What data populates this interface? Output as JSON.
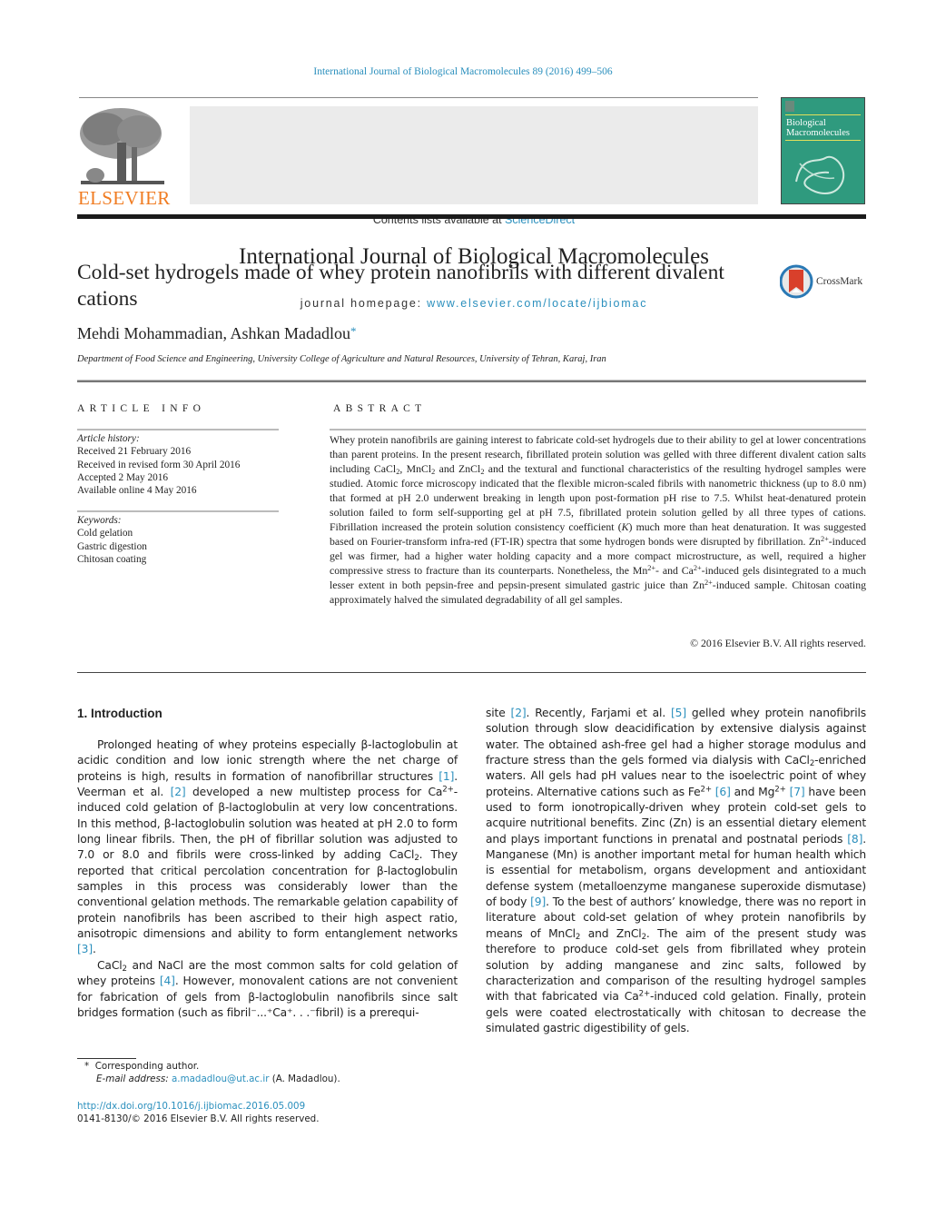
{
  "running_head": "International Journal of Biological Macromolecules 89 (2016) 499–506",
  "header": {
    "publisher": "ELSEVIER",
    "contents_prefix": "Contents lists available at ",
    "contents_link": "ScienceDirect",
    "journal_title": "International Journal of Biological Macromolecules",
    "homepage_prefix": "journal homepage: ",
    "homepage_link": "www.elsevier.com/locate/ijbiomac",
    "cover_title_line1": "Biological",
    "cover_title_line2": "Macromolecules",
    "cover_color": "#2f9a7e",
    "publisher_color": "#f07c22",
    "link_color": "#2a8fbd"
  },
  "article": {
    "title": "Cold-set hydrogels made of whey protein nanofibrils with different divalent cations",
    "crossmark_label": "CrossMark",
    "authors": "Mehdi Mohammadian, Ashkan Madadlou",
    "author_mark": "*",
    "affiliation": "Department of Food Science and Engineering, University College of Agriculture and Natural Resources, University of Tehran, Karaj, Iran"
  },
  "article_info": {
    "heading": "ARTICLE INFO",
    "history_label": "Article history:",
    "history": [
      "Received 21 February 2016",
      "Received in revised form 30 April 2016",
      "Accepted 2 May 2016",
      "Available online 4 May 2016"
    ],
    "keywords_label": "Keywords:",
    "keywords": [
      "Cold gelation",
      "Gastric digestion",
      "Chitosan coating"
    ]
  },
  "abstract": {
    "heading": "ABSTRACT",
    "s1": "Whey protein nanofibrils are gaining interest to fabricate cold-set hydrogels due to their ability to gel at lower concentrations than parent proteins. In the present research, fibrillated protein solution was gelled with three different divalent cation salts including CaCl",
    "s2": ", MnCl",
    "s3": " and ZnCl",
    "s4": " and the textural and functional characteristics of the resulting hydrogel samples were studied. Atomic force microscopy indicated that the flexible micron-scaled fibrils with nanometric thickness (up to 8.0 nm) that formed at pH 2.0 underwent breaking in length upon post-formation pH rise to 7.5. Whilst heat-denatured protein solution failed to form self-supporting gel at pH 7.5, fibrillated protein solution gelled by all three types of cations. Fibrillation increased the protein solution consistency coefficient (",
    "k": "K",
    "s5": ") much more than heat denaturation. It was suggested based on Fourier-transform infra-red (FT-IR) spectra that some hydrogen bonds were disrupted by fibrillation. Zn",
    "s6": "-induced gel was firmer, had a higher water holding capacity and a more compact microstructure, as well, required a higher compressive stress to fracture than its counterparts. Nonetheless, the Mn",
    "s7": "- and Ca",
    "s8": "-induced gels disintegrated to a much lesser extent in both pepsin-free and pepsin-present simulated gastric juice than Zn",
    "s9": "-induced sample. Chitosan coating approximately halved the simulated degradability of all gel samples.",
    "sub2": "2",
    "sup2p": "2+",
    "copyright": "© 2016 Elsevier B.V. All rights reserved."
  },
  "intro": {
    "heading": "1.  Introduction",
    "p1": {
      "a": "Prolonged heating of whey proteins especially β-lactoglobulin at acidic condition and low ionic strength where the net charge of proteins is high, results in formation of nanofibrillar structures ",
      "r1": "[1]",
      "b": ". Veerman et al. ",
      "r2": "[2]",
      "c": " developed a new multistep process for Ca",
      "d": "-induced cold gelation of β-lactoglobulin at very low concentrations. In this method, β-lactoglobulin solution was heated at pH 2.0 to form long linear fibrils. Then, the pH of fibrillar solution was adjusted to 7.0 or 8.0 and fibrils were cross-linked by adding CaCl",
      "e": ". They reported that critical percolation concentration for β-lactoglobulin samples in this process was considerably lower than the conventional gelation methods. The remarkable gelation capability of protein nanofibrils has been ascribed to their high aspect ratio, anisotropic dimensions and ability to form entanglement networks ",
      "r3": "[3]",
      "f": "."
    },
    "p2": {
      "a": "CaCl",
      "b": " and NaCl are the most common salts for cold gelation of whey proteins ",
      "r4": "[4]",
      "c": ". However, monovalent cations are not convenient for fabrication of gels from β-lactoglobulin nanofibrils since salt bridges formation (such as fibril⁻...⁺Ca⁺. . .⁻fibril) is a prerequisite ",
      "r2": "[2]",
      "d": ". Recently, Farjami et al. ",
      "r5": "[5]",
      "e": " gelled whey protein nanofibrils solution through slow deacidification by extensive dialysis against water. The obtained ash-free gel had a higher storage modulus and fracture stress than the gels formed via dialysis with CaCl",
      "f": "-enriched waters. All gels had pH values near to the isoelectric point of whey proteins. Alternative cations such as Fe",
      "r6": "[6]",
      "g": " and Mg",
      "r7": "[7]",
      "h": " have been used to form ionotropically-driven whey protein cold-set gels to acquire nutritional benefits. Zinc (Zn) is an essential dietary element and plays important functions in prenatal and postnatal periods ",
      "r8": "[8]",
      "i": ". Manganese (Mn) is another important metal for human health which is essential for metabolism, organs development and antioxidant defense system (metalloenzyme manganese superoxide dismutase) of body ",
      "r9": "[9]",
      "j": ". To the best of authors’ knowledge, there was no report in literature about cold-set gelation of whey protein nanofibrils by means of MnCl",
      "k": " and ZnCl",
      "l": ". The aim of the present study was therefore to produce cold-set gels from fibrillated whey protein solution by adding manganese and zinc salts, followed by characterization and comparison of the resulting hydrogel samples with that fabricated via Ca",
      "m": "-induced cold gelation. Finally, protein gels were coated electrostatically with chitosan to decrease the simulated gastric digestibility of gels."
    }
  },
  "footnotes": {
    "mark": "*",
    "corresponding": "Corresponding author.",
    "email_label": "E-mail address:",
    "email": "a.madadlou@ut.ac.ir",
    "email_suffix": " (A. Madadlou).",
    "doi": "http://dx.doi.org/10.1016/j.ijbiomac.2016.05.009",
    "issn": "0141-8130/© 2016 Elsevier B.V. All rights reserved."
  }
}
